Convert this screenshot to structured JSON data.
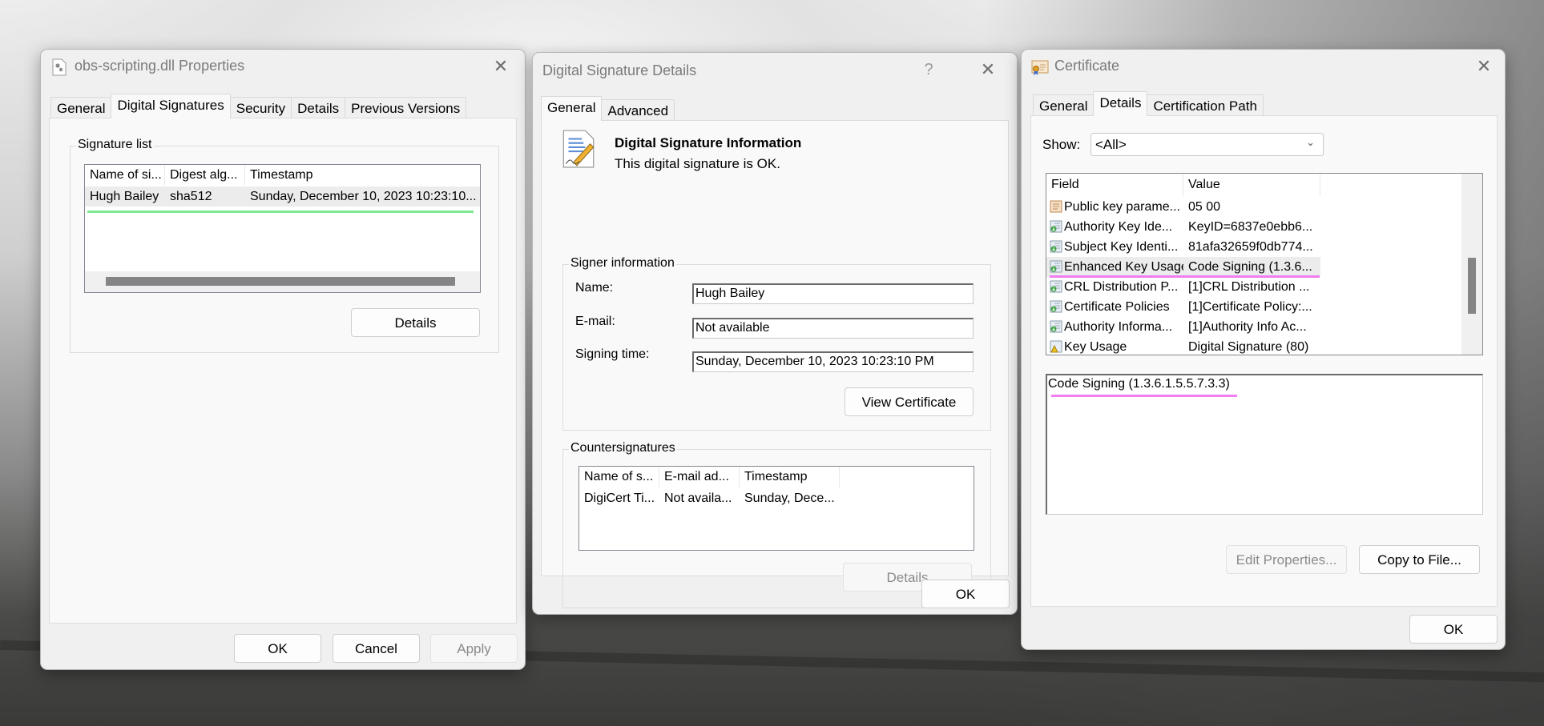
{
  "properties_dialog": {
    "title": "obs-scripting.dll Properties",
    "icon": "dll-file-gear-icon",
    "tabs": [
      {
        "label": "General",
        "active": false
      },
      {
        "label": "Digital Signatures",
        "active": true
      },
      {
        "label": "Security",
        "active": false
      },
      {
        "label": "Details",
        "active": false
      },
      {
        "label": "Previous Versions",
        "active": false
      }
    ],
    "signature_list": {
      "group_label": "Signature list",
      "columns": [
        "Name of si...",
        "Digest alg...",
        "Timestamp"
      ],
      "rows": [
        {
          "name": "Hugh Bailey",
          "digest": "sha512",
          "timestamp": "Sunday, December 10, 2023 10:23:10...",
          "selected": true
        }
      ]
    },
    "details_button": "Details",
    "buttons": {
      "ok": "OK",
      "cancel": "Cancel",
      "apply": "Apply"
    },
    "highlight_color": "#7dea8f"
  },
  "signature_details_dialog": {
    "title": "Digital Signature Details",
    "help_glyph": "?",
    "tabs": [
      {
        "label": "General",
        "active": true
      },
      {
        "label": "Advanced",
        "active": false
      }
    ],
    "info": {
      "heading": "Digital Signature Information",
      "status": "This digital signature is OK.",
      "icon": "signed-document-pen-icon"
    },
    "signer_information": {
      "group_label": "Signer information",
      "name_label": "Name:",
      "name_value": "Hugh Bailey",
      "email_label": "E-mail:",
      "email_value": "Not available",
      "signing_time_label": "Signing time:",
      "signing_time_value": "Sunday, December 10, 2023 10:23:10 PM",
      "view_certificate_button": "View Certificate"
    },
    "countersignatures": {
      "group_label": "Countersignatures",
      "columns": [
        "Name of s...",
        "E-mail ad...",
        "Timestamp"
      ],
      "rows": [
        {
          "name": "DigiCert Ti...",
          "email": "Not availa...",
          "timestamp": "Sunday, Dece..."
        }
      ],
      "details_button": "Details"
    },
    "ok_button": "OK"
  },
  "certificate_dialog": {
    "title": "Certificate",
    "icon": "certificate-ribbon-icon",
    "tabs": [
      {
        "label": "General",
        "active": false
      },
      {
        "label": "Details",
        "active": true
      },
      {
        "label": "Certification Path",
        "active": false
      }
    ],
    "show_label": "Show:",
    "show_value": "<All>",
    "fields_list": {
      "columns": [
        "Field",
        "Value"
      ],
      "rows": [
        {
          "field": "Public key parame...",
          "value": "05 00",
          "icon": "public-key-params-icon",
          "selected": false
        },
        {
          "field": "Authority Key Ide...",
          "value": "KeyID=6837e0ebb6...",
          "icon": "extension-icon",
          "selected": false
        },
        {
          "field": "Subject Key Identi...",
          "value": "81afa32659f0db774...",
          "icon": "extension-icon",
          "selected": false
        },
        {
          "field": "Enhanced Key Usage",
          "value": "Code Signing (1.3.6...",
          "icon": "extension-icon",
          "selected": true
        },
        {
          "field": "CRL Distribution P...",
          "value": "[1]CRL Distribution ...",
          "icon": "extension-icon",
          "selected": false
        },
        {
          "field": "Certificate Policies",
          "value": "[1]Certificate Policy:...",
          "icon": "extension-icon",
          "selected": false
        },
        {
          "field": "Authority Informa...",
          "value": "[1]Authority Info Ac...",
          "icon": "extension-icon",
          "selected": false
        },
        {
          "field": "Key Usage",
          "value": "Digital Signature (80)",
          "icon": "critical-extension-warning-icon",
          "selected": false
        }
      ]
    },
    "detail_text": "Code Signing (1.3.6.1.5.5.7.3.3)",
    "edit_properties_button": "Edit Properties...",
    "copy_to_file_button": "Copy to File...",
    "ok_button": "OK",
    "highlight_color": "#f07ef0"
  }
}
